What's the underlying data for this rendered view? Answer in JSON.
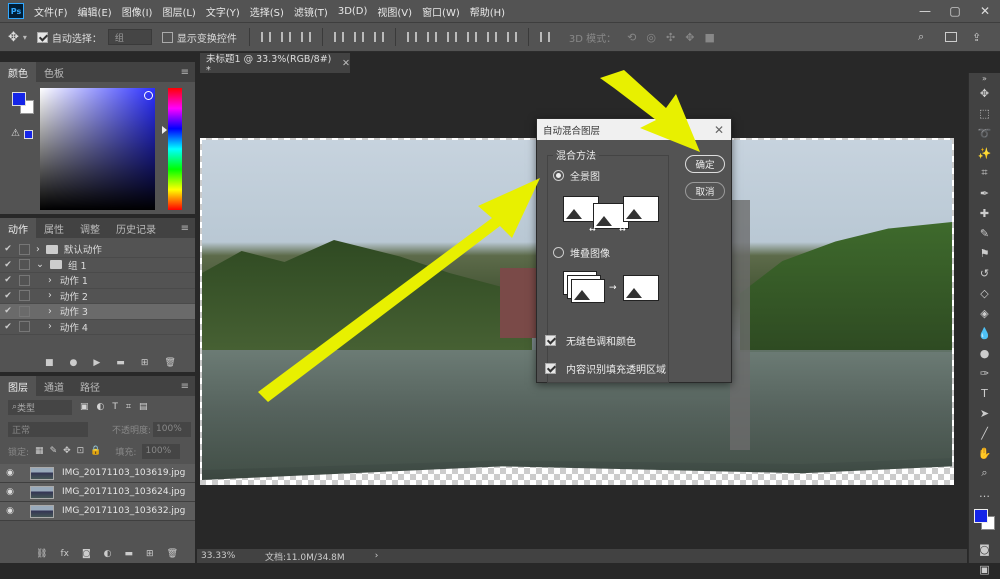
{
  "app": {
    "logo": "Ps"
  },
  "menu": [
    "文件(F)",
    "编辑(E)",
    "图像(I)",
    "图层(L)",
    "文字(Y)",
    "选择(S)",
    "滤镜(T)",
    "3D(D)",
    "视图(V)",
    "窗口(W)",
    "帮助(H)"
  ],
  "window_controls": {
    "minimize": "—",
    "restore": "▢",
    "close": "✕"
  },
  "options": {
    "auto_select_label": "自动选择：",
    "auto_select_value": "组",
    "show_transform_label": "显示变换控件",
    "mode_3d_label": "3D 模式："
  },
  "color_panel": {
    "tabs": [
      "颜色",
      "色板"
    ],
    "fg_color": "#1525e8",
    "bg_color": "#ffffff"
  },
  "actions_panel": {
    "tabs": [
      "动作",
      "属性",
      "调整",
      "历史记录"
    ],
    "rows": [
      {
        "label": "默认动作",
        "type": "set",
        "indent": 0
      },
      {
        "label": "组 1",
        "type": "set",
        "indent": 0
      },
      {
        "label": "动作 1",
        "type": "action",
        "indent": 1
      },
      {
        "label": "动作 2",
        "type": "action",
        "indent": 1
      },
      {
        "label": "动作 3",
        "type": "action",
        "indent": 1,
        "selected": true
      },
      {
        "label": "动作 4",
        "type": "action",
        "indent": 1
      }
    ]
  },
  "layers_panel": {
    "tabs": [
      "图层",
      "通道",
      "路径"
    ],
    "filter_label": "类型",
    "blend_mode": "正常",
    "opacity_label": "不透明度:",
    "opacity_value": "100%",
    "lock_label": "锁定:",
    "fill_label": "填充:",
    "fill_value": "100%",
    "layers": [
      "IMG_20171103_103619.jpg",
      "IMG_20171103_103624.jpg",
      "IMG_20171103_103632.jpg"
    ]
  },
  "document": {
    "tab_title": "未标题1 @ 33.3%(RGB/8#) *",
    "zoom": "33.33%",
    "doc_info": "文档:11.0M/34.8M"
  },
  "dialog": {
    "title": "自动混合图层",
    "group_label": "混合方法",
    "option_panorama": "全景图",
    "option_stack": "堆叠图像",
    "checkbox_seamless": "无缝色调和颜色",
    "checkbox_content_aware": "内容识别填充透明区域",
    "ok_label": "确定",
    "cancel_label": "取消"
  },
  "annotation_arrow_color": "#e8f000"
}
